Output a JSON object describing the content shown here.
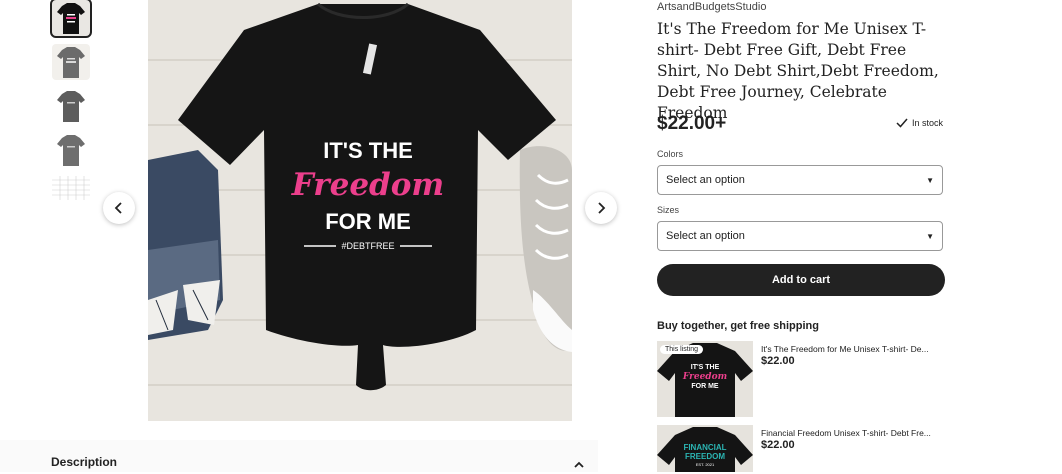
{
  "gallery": {
    "thumbnails": [
      "black-tshirt-thumb",
      "gray-tshirt-thumb",
      "gray-tshirt-thumb-2",
      "gray-tshirt-thumb-3",
      "size-chart-thumb"
    ],
    "main_print": {
      "line1": "IT'S THE",
      "line2": "Freedom",
      "line3": "FOR ME",
      "hashtag": "#DEBTFREE"
    },
    "prev_icon": "chevron-left-icon",
    "next_icon": "chevron-right-icon"
  },
  "description": {
    "label": "Description",
    "toggle_icon": "chevron-up-icon"
  },
  "listing": {
    "shop_name": "ArtsandBudgetsStudio",
    "title": "It's The Freedom for Me Unisex T-shirt- Debt Free Gift, Debt Free Shirt, No Debt Shirt,Debt Freedom, Debt Free Journey, Celebrate Freedom",
    "price": "$22.00+",
    "stock": "In stock",
    "colors_label": "Colors",
    "colors_value": "Select an option",
    "sizes_label": "Sizes",
    "sizes_value": "Select an option",
    "add_to_cart": "Add to cart"
  },
  "bundle": {
    "title": "Buy together, get free shipping",
    "items": [
      {
        "tag": "This listing",
        "name": "It's The Freedom for Me Unisex T-shirt- De...",
        "price": "$22.00",
        "print_lines": [
          "IT'S THE",
          "Freedom",
          "FOR ME"
        ]
      },
      {
        "name": "Financial Freedom Unisex T-shirt- Debt Fre...",
        "price": "$22.00",
        "print_lines": [
          "FINANCIAL",
          "FREEDOM",
          "EST. 2021"
        ]
      }
    ]
  },
  "colors": {
    "brand_dark": "#222222",
    "accent_pink": "#ec3f8c",
    "accent_teal": "#2bb5b3"
  }
}
